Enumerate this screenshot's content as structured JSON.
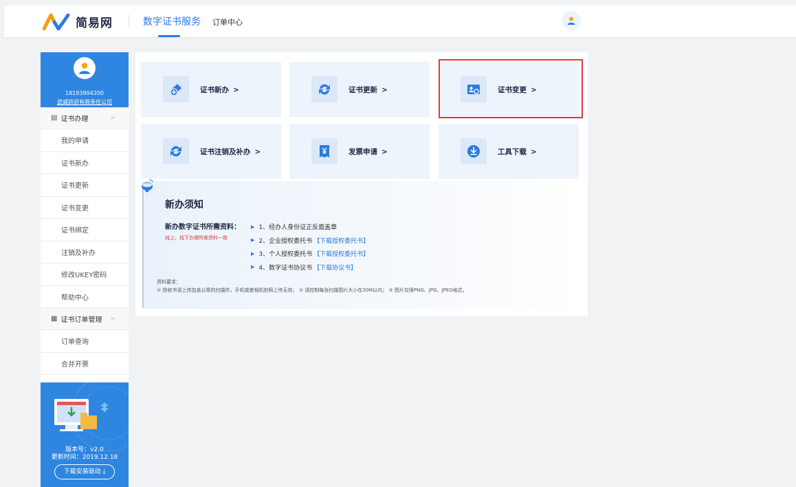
{
  "header": {
    "logo_text": "简易网",
    "nav_service": "数字证书服务",
    "nav_order": "订单中心"
  },
  "sidebar": {
    "phone": "18193994200",
    "company": "武威骄骄有限责任公司",
    "group1_label": "证书办理",
    "group1_items": [
      "我的申请",
      "证书新办",
      "证书更新",
      "证书变更",
      "证书绑定",
      "注销及补办",
      "修改UKEY密码",
      "帮助中心"
    ],
    "group2_label": "证书订单管理",
    "group2_items": [
      "订单查询",
      "合并开票"
    ],
    "chevron": ">"
  },
  "promo": {
    "version": "版本号：v2.0",
    "update_time": "更新时间：2019.12.18",
    "download_button": "下载安装驱动 ⤓"
  },
  "cards": [
    {
      "label": "证书新办",
      "icon": "add-certificate-icon"
    },
    {
      "label": "证书更新",
      "icon": "refresh-icon"
    },
    {
      "label": "证书变更",
      "icon": "id-card-change-icon"
    },
    {
      "label": "证书注销及补办",
      "icon": "refresh-icon"
    },
    {
      "label": "发票申请",
      "icon": "invoice-icon"
    },
    {
      "label": "工具下载",
      "icon": "download-icon"
    }
  ],
  "card_arrow": ">",
  "notice": {
    "title": "新办须知",
    "requirement_label": "新办数字证书所需资料：",
    "requirement_note": "线上、线下办理所需资料一致",
    "items": [
      {
        "text": "1、经办人身份证正反面盖章",
        "link": ""
      },
      {
        "text": "2、企业授权委托书",
        "link": "【下载授权委托书】"
      },
      {
        "text": "3、个人授权委托书",
        "link": "【下载授权委托书】"
      },
      {
        "text": "4、数字证书协议书",
        "link": "【下载协议书】"
      }
    ],
    "spec_title": "资料要求：",
    "spec_text": "① 授权书请上传加盖公章的扫描件，手机或者相机拍照上传无效；  ② 请控制每张扫描图片大小在20M以内；  ③ 图片仅限PNG、JPG、JPEG格式。"
  },
  "colors": {
    "brand_blue": "#2b7be0",
    "sidebar_blue": "#2e86e0",
    "highlight_red": "#e0373a"
  }
}
